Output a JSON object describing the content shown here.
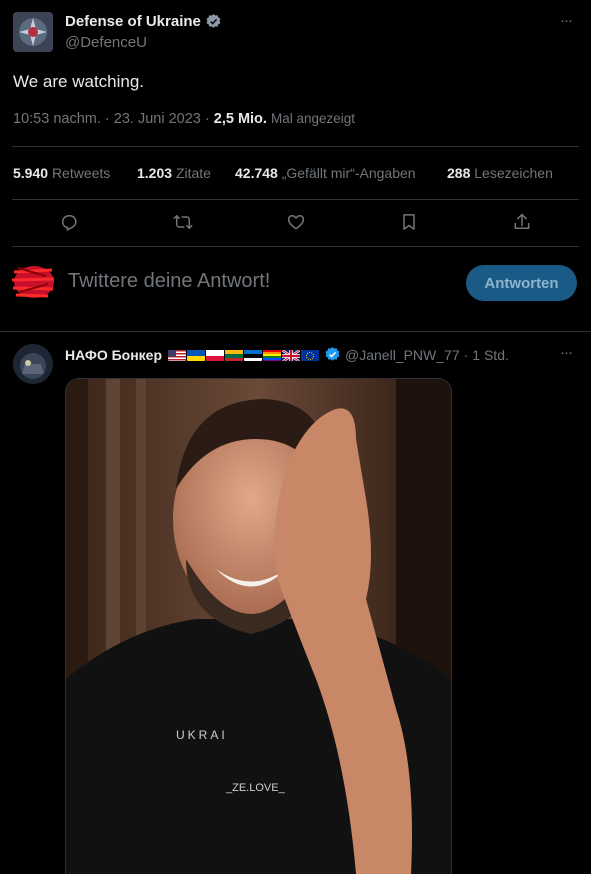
{
  "tweet": {
    "author_name": "Defense of Ukraine",
    "author_handle": "@DefenceU",
    "text": "We are watching.",
    "time": "10:53 nachm.",
    "date": "23. Juni 2023",
    "views_count": "2,5 Mio.",
    "views_label": "Mal angezeigt",
    "sep": "·",
    "stats": {
      "retweets_count": "5.940",
      "retweets_label": "Retweets",
      "quotes_count": "1.203",
      "quotes_label": "Zitate",
      "likes_count": "42.748",
      "likes_label": "„Gefällt mir“-Angaben",
      "bookmarks_count": "288",
      "bookmarks_label": "Lesezeichen"
    },
    "more_label": "···"
  },
  "actions": [
    "reply-icon",
    "retweet-icon",
    "like-icon",
    "bookmark-icon",
    "share-icon"
  ],
  "reply_box": {
    "placeholder": "Twittere deine Antwort!",
    "button_label": "Antworten"
  },
  "reply": {
    "author_name": "НАФО Бонкер",
    "author_handle": "@Janell_PNW_77",
    "time": "1 Std.",
    "sep": "·",
    "more_label": "···",
    "flags": [
      "US",
      "UA",
      "PL",
      "LT",
      "EE",
      "Pride",
      "GB",
      "EU"
    ],
    "image_text_1": "UKRAI",
    "image_text_2": "_ZE.LOVE_"
  },
  "colors": {
    "background": "#000000",
    "text": "#e7e9ea",
    "muted": "#71767b",
    "accent": "#1d9bf0",
    "button_bg": "#1a5a86",
    "divider": "#2f3336"
  }
}
